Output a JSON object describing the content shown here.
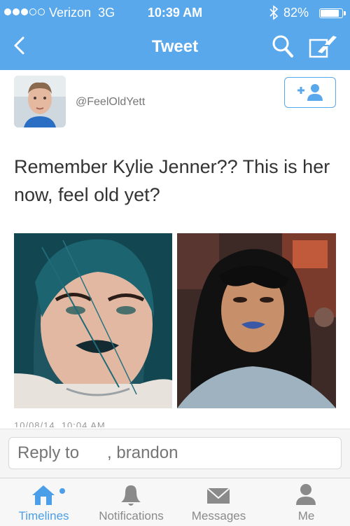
{
  "status_bar": {
    "carrier": "Verizon",
    "network": "3G",
    "time": "10:39 AM",
    "battery": "82%",
    "battery_level": 0.82,
    "signal_dots_filled": 3,
    "signal_dots_total": 5
  },
  "nav": {
    "title": "Tweet",
    "icons": [
      "back-chevron-icon",
      "search-icon",
      "compose-icon"
    ]
  },
  "tweet": {
    "username": "@FeelOldYett",
    "text": "Remember Kylie Jenner?? This is her now, feel old yet?",
    "timestamp": "10/08/14, 10:04 AM",
    "images": [
      "teal-hair-portrait",
      "dark-hair-portrait"
    ]
  },
  "reply": {
    "placeholder": "Reply to      , brandon"
  },
  "tabs": [
    {
      "label": "Timelines",
      "icon": "home-icon",
      "active": true
    },
    {
      "label": "Notifications",
      "icon": "bell-icon",
      "active": false
    },
    {
      "label": "Messages",
      "icon": "envelope-icon",
      "active": false
    },
    {
      "label": "Me",
      "icon": "person-icon",
      "active": false
    }
  ],
  "colors": {
    "accent": "#5aa8ec",
    "active_tab": "#4b9ee8",
    "inactive_tab": "#8a8a8a"
  }
}
